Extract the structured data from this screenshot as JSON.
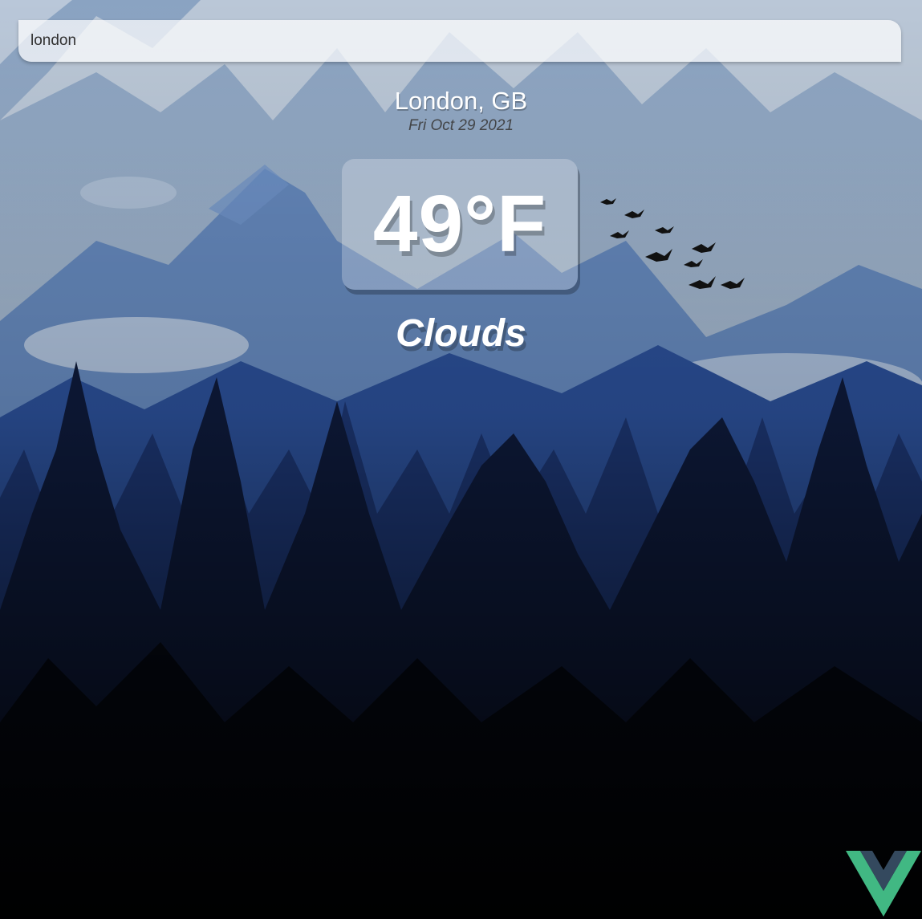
{
  "search": {
    "value": "london"
  },
  "location": {
    "city": "London, GB",
    "date": "Fri Oct 29 2021"
  },
  "weather": {
    "temperature": "49°F",
    "condition": "Clouds"
  },
  "icons": {
    "logo": "vue-logo-icon"
  },
  "colors": {
    "sky": "#8fa7c4",
    "mountain_far": "#5b80b9",
    "mountain_near": "#2f5aa6",
    "forest": "#0b1222",
    "vue_green": "#41b883",
    "vue_dark": "#34495e"
  }
}
